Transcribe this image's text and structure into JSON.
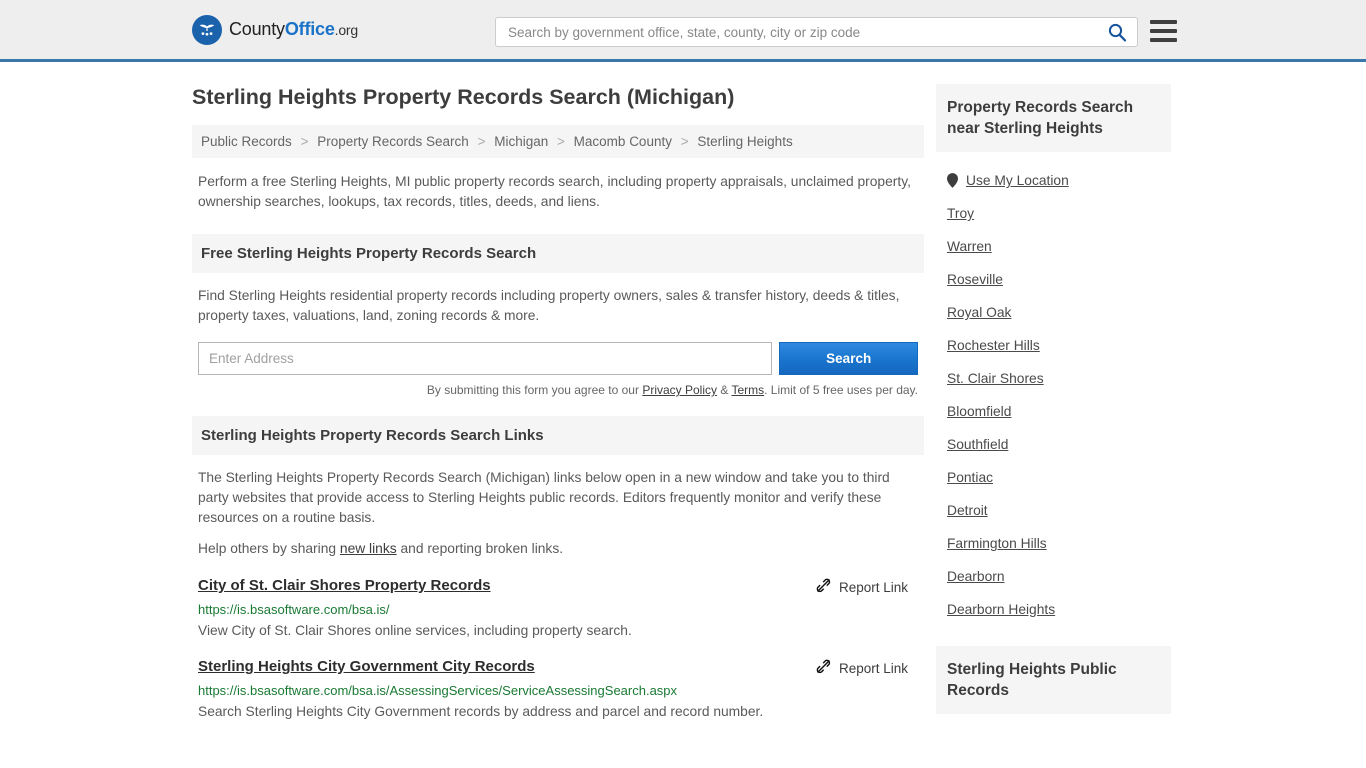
{
  "header": {
    "logo": {
      "icon": "eagle-shield-icon",
      "text_county": "County",
      "text_office": "Office",
      "text_tld": ".org"
    },
    "search": {
      "placeholder": "Search by government office, state, county, city or zip code",
      "value": "",
      "icon": "search-icon"
    },
    "menu_icon": "hamburger-menu-icon"
  },
  "main": {
    "title": "Sterling Heights Property Records Search (Michigan)",
    "breadcrumb": [
      "Public Records",
      "Property Records Search",
      "Michigan",
      "Macomb County",
      "Sterling Heights"
    ],
    "breadcrumb_separator": ">",
    "lead": "Perform a free Sterling Heights, MI public property records search, including property appraisals, unclaimed property, ownership searches, lookups, tax records, titles, deeds, and liens.",
    "free_search": {
      "heading": "Free Sterling Heights Property Records Search",
      "description": "Find Sterling Heights residential property records including property owners, sales & transfer history, deeds & titles, property taxes, valuations, land, zoning records & more.",
      "input_placeholder": "Enter Address",
      "input_value": "",
      "button_label": "Search",
      "note_prefix": "By submitting this form you agree to our ",
      "note_privacy": "Privacy Policy",
      "note_amp": " & ",
      "note_terms": "Terms",
      "note_suffix": ". Limit of 5 free uses per day."
    },
    "links_section": {
      "heading": "Sterling Heights Property Records Search Links",
      "paragraph": "The Sterling Heights Property Records Search (Michigan) links below open in a new window and take you to third party websites that provide access to Sterling Heights public records. Editors frequently monitor and verify these resources on a routine basis.",
      "help_prefix": "Help others by sharing ",
      "help_link": "new links",
      "help_suffix": " and reporting broken links.",
      "report_label": "Report Link",
      "report_icon": "broken-link-icon",
      "results": [
        {
          "title": "City of St. Clair Shores Property Records",
          "url": "https://is.bsasoftware.com/bsa.is/",
          "description": "View City of St. Clair Shores online services, including property search."
        },
        {
          "title": "Sterling Heights City Government City Records",
          "url": "https://is.bsasoftware.com/bsa.is/AssessingServices/ServiceAssessingSearch.aspx",
          "description": "Search Sterling Heights City Government records by address and parcel and record number."
        }
      ]
    }
  },
  "sidebar": {
    "nearby_heading": "Property Records Search near Sterling Heights",
    "use_my_location": {
      "label": "Use My Location",
      "icon": "map-pin-icon"
    },
    "cities": [
      "Troy",
      "Warren",
      "Roseville",
      "Royal Oak",
      "Rochester Hills",
      "St. Clair Shores",
      "Bloomfield",
      "Southfield",
      "Pontiac",
      "Detroit",
      "Farmington Hills",
      "Dearborn",
      "Dearborn Heights"
    ],
    "public_records_heading": "Sterling Heights Public Records"
  },
  "colors": {
    "header_bg": "#eeeeee",
    "header_border": "#3a78ab",
    "brand_blue": "#1a73c8",
    "button_blue": "#1874cd",
    "url_green": "#1a7a33",
    "panel_gray": "#f5f5f5"
  }
}
